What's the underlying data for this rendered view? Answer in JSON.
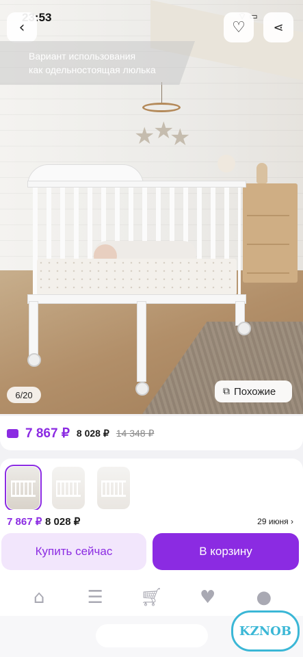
{
  "status_bar": {
    "time": "23:53",
    "indicators": "wifi-icon battery-icon"
  },
  "top_actions": {
    "back_icon": "chevron-left-icon",
    "favorite_icon": "heart-icon",
    "share_icon": "share-icon"
  },
  "gallery": {
    "caption_line1": "Вариант использования",
    "caption_line2": "как одельностоящая люлька",
    "counter": "6/20",
    "similar_label": "Похожие"
  },
  "price": {
    "main": "7 867 ₽",
    "second": "8 028 ₽",
    "old": "14 348 ₽"
  },
  "buy_bar": {
    "price_main": "7 867 ₽",
    "price_second": "8 028 ₽",
    "delivery_date": "29 июня",
    "buy_now_label": "Купить сейчас",
    "add_to_cart_label": "В корзину"
  },
  "tabs": [
    "home-icon",
    "catalog-search-icon",
    "cart-icon",
    "favorites-icon",
    "profile-icon"
  ],
  "watermark_text": "KZNOB",
  "colors": {
    "accent": "#8b2be2",
    "accent_light": "#f2e6fc"
  }
}
